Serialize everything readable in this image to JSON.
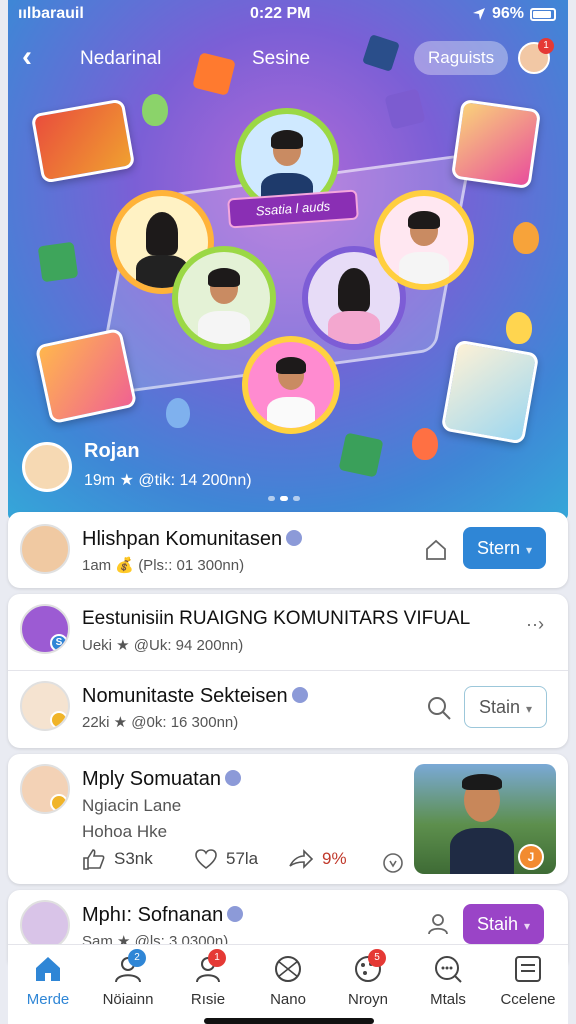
{
  "status_bar": {
    "carrier": "ıılbarauil",
    "time": "0:22 PM",
    "battery": "96%"
  },
  "nav": {
    "title_left": "Nedarinal",
    "title_center": "Sesine",
    "action_pill": "Raguists",
    "profile_notifications": "1"
  },
  "hero": {
    "banner": "Ssatia l auds",
    "owner_name": "Rojan",
    "owner_meta": "19m ★ @tik: 14 200nn)",
    "carousel_pages": 3,
    "carousel_active": 1
  },
  "feed": [
    {
      "title": "Hlishpan Komunitasen",
      "meta": "1am 💰 (Pls:: 01 300nn)",
      "button": "Stern"
    },
    {
      "title": "Eestunisiin RUAIGNG KOMUNITARS VIFUAL",
      "meta": "Ueki ★ @Uk: 94 200nn)"
    },
    {
      "title": "Nomunitaste Sekteisen",
      "meta": "22ki ★ @0k: 16 300nn)",
      "button": "Stain"
    },
    {
      "title": "Mply Somuatan",
      "line1": "Ngiacin Lane",
      "line2": "Hohoa Hke",
      "actions": {
        "like": "S3nk",
        "love": "57la",
        "share": "9%"
      }
    },
    {
      "title": "Mphı: Sofnanan",
      "meta": "Sam ★ @ls: 3 0300n)",
      "button": "Staih"
    }
  ],
  "tabs": [
    {
      "label": "Merde",
      "icon": "home-icon",
      "active": true
    },
    {
      "label": "Nöiainn",
      "icon": "people-icon",
      "badge": "2"
    },
    {
      "label": "Rısie",
      "icon": "person-icon",
      "badge": "1"
    },
    {
      "label": "Nano",
      "icon": "ball-icon"
    },
    {
      "label": "Nroyn",
      "icon": "palette-icon",
      "badge": "5"
    },
    {
      "label": "Mtals",
      "icon": "chat-search-icon"
    },
    {
      "label": "Ccelene",
      "icon": "list-icon"
    }
  ],
  "colors": {
    "accent": "#2f86d6",
    "purple": "#9a44c7",
    "badge_red": "#e53935"
  }
}
